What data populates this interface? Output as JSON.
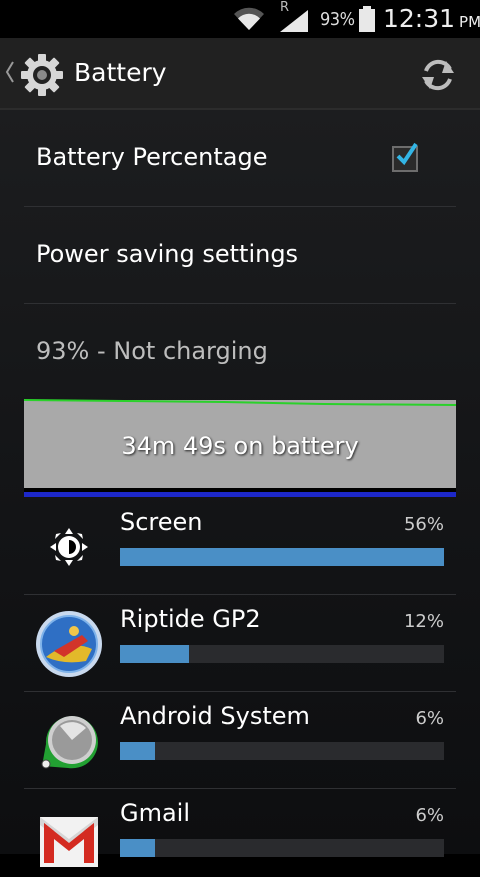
{
  "status_bar": {
    "roaming_indicator": "R",
    "battery_percent": "93%",
    "time": "12:31",
    "ampm": "PM"
  },
  "action_bar": {
    "title": "Battery",
    "icons": [
      "back-chevron-icon",
      "settings-gear-icon",
      "refresh-icon"
    ]
  },
  "settings": [
    {
      "label": "Battery Percentage",
      "checked": true
    },
    {
      "label": "Power saving settings"
    }
  ],
  "battery_status": "93% - Not charging",
  "graph": {
    "label": "34m 49s on battery",
    "colors": {
      "line": "#2ad12a",
      "background": "#a9a9a9",
      "bar": "#1d28c9"
    }
  },
  "usage": [
    {
      "name": "Screen",
      "percent_label": "56%",
      "fill": 1.0,
      "icon": "brightness-icon"
    },
    {
      "name": "Riptide GP2",
      "percent_label": "12%",
      "fill": 0.214,
      "icon": "riptide-app-icon"
    },
    {
      "name": "Android System",
      "percent_label": "6%",
      "fill": 0.107,
      "icon": "android-system-icon"
    },
    {
      "name": "Gmail",
      "percent_label": "6%",
      "fill": 0.107,
      "icon": "gmail-icon"
    }
  ]
}
